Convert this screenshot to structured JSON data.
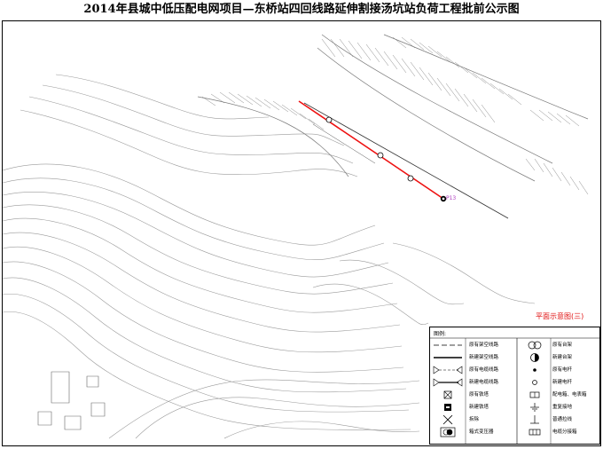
{
  "title": "2014年县城中低压配电网项目—东桥站四回线路延伸割接汤坑站负荷工程批前公示图",
  "subtitle": "平面示意图(三)",
  "pole_label": "P13",
  "colors": {
    "new_line": "#ee1111",
    "contour": "#9a9a9a",
    "frame": "#000000"
  },
  "legend": {
    "title": "图例:",
    "left": [
      {
        "label": "原有架空线路",
        "icon": "dash-line-icon"
      },
      {
        "label": "新建架空线路",
        "icon": "bold-line-icon"
      },
      {
        "label": "原有电缆线路",
        "icon": "cable-terminal-line-icon"
      },
      {
        "label": "新建电缆线路",
        "icon": "cable-terminal-line-icon"
      },
      {
        "label": "原有铁塔",
        "icon": "square-x-icon"
      },
      {
        "label": "新建铁塔",
        "icon": "filled-tower-icon"
      },
      {
        "label": "拆除",
        "icon": "x-mark-icon"
      },
      {
        "label": "箱式变压器",
        "icon": "box-transformer-icon"
      }
    ],
    "right": [
      {
        "label": "原有台架",
        "icon": "double-circle-icon"
      },
      {
        "label": "新建台架",
        "icon": "half-filled-circle-icon"
      },
      {
        "label": "原有电杆",
        "icon": "dot-icon"
      },
      {
        "label": "新建电杆",
        "icon": "circle-icon"
      },
      {
        "label": "配电箱、电表箱",
        "icon": "meter-box-icon"
      },
      {
        "label": "重复接地",
        "icon": "ground-icon"
      },
      {
        "label": "普通拉线",
        "icon": "guy-wire-icon"
      },
      {
        "label": "电缆分接箱",
        "icon": "branch-box-icon"
      }
    ]
  }
}
